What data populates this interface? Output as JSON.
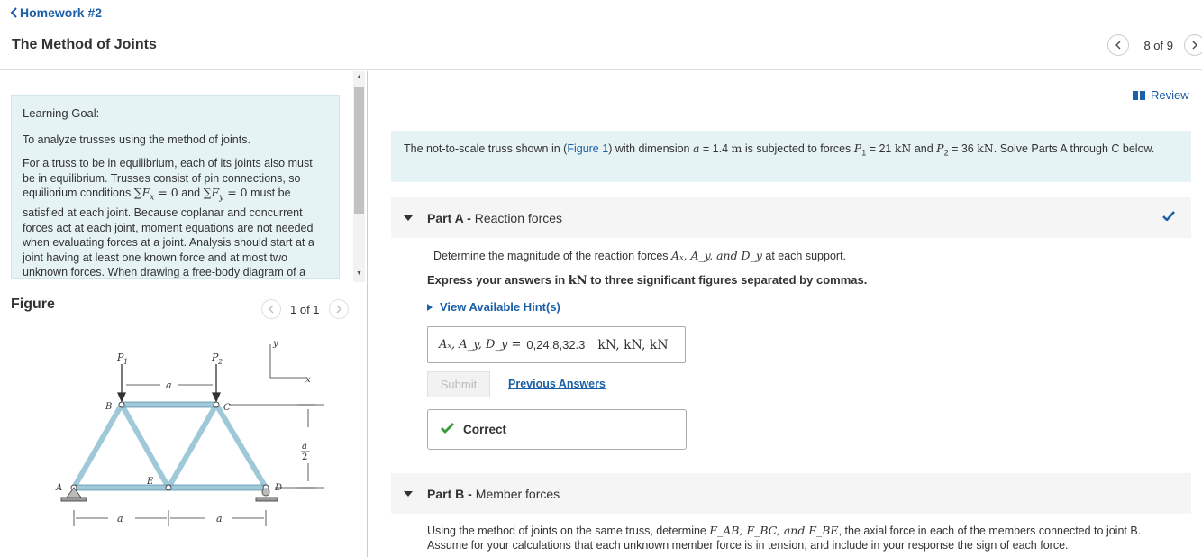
{
  "header": {
    "back_label": "Homework #2",
    "title": "The Method of Joints",
    "pager_text": "8 of 9"
  },
  "learning_goal": {
    "title": "Learning Goal:",
    "p1": "To analyze trusses using the method of joints.",
    "p2_a": "For a truss to be in equilibrium, each of its joints also must be in equilibrium. Trusses consist of pin connections, so equilibrium conditions ",
    "eq1": "∑F",
    "eq1_sub": "x",
    "eq1_rhs": " = 0",
    "p2_and": " and ",
    "eq2": "∑F",
    "eq2_sub": "y",
    "eq2_rhs": " = 0",
    "p2_b": " must be satisfied at each joint. Because coplanar and concurrent forces act at each joint, moment equations are not needed when evaluating forces at a joint. Analysis should start at a joint having at least one known force and at most two unknown forces. When drawing a free-body diagram of a joint, always assume unknown member forces are in"
  },
  "figure": {
    "label": "Figure",
    "pager_text": "1 of 1",
    "labels": {
      "P1": "P",
      "P1_sub": "1",
      "P2": "P",
      "P2_sub": "2",
      "a_top": "a",
      "y": "y",
      "x": "x",
      "B": "B",
      "C": "C",
      "A": "A",
      "D": "D",
      "E": "E",
      "half_num": "a",
      "half_den": "2",
      "a_left": "a",
      "a_right": "a"
    }
  },
  "review": {
    "label": "Review"
  },
  "intro": {
    "text_a": "The not-to-scale truss shown in (",
    "figure_link": "Figure 1",
    "text_b": ") with dimension ",
    "a_var": "a",
    "a_eq": " = 1.4 ",
    "a_unit": "m",
    "text_c": " is subjected to forces ",
    "p1_var": "P",
    "p1_sub": "1",
    "p1_eq": " = 21 ",
    "p1_unit": "kN",
    "text_d": " and ",
    "p2_var": "P",
    "p2_sub": "2",
    "p2_eq": " = 36 ",
    "p2_unit": "kN",
    "text_e": ". Solve Parts A through C below."
  },
  "part_a": {
    "part_label": "Part A - ",
    "part_title": "Reaction forces",
    "question_a": "Determine the magnitude of the reaction forces ",
    "question_vars": "Aₓ, A_y, and D_y",
    "question_b": " at each support.",
    "express_a": "Express your answers in ",
    "express_unit": "kN",
    "express_b": " to three significant figures separated by commas.",
    "hints_label": "View Available Hint(s)",
    "answer_label": "Aₓ, A_y, D_y =",
    "answer_value": "0,24.8,32.3",
    "answer_units": "kN, kN, kN",
    "submit_label": "Submit",
    "previous_answers_label": "Previous Answers",
    "correct_label": "Correct"
  },
  "part_b": {
    "part_label": "Part B - ",
    "part_title": "Member forces",
    "question_a": "Using the method of joints on the same truss, determine ",
    "question_vars": "F_AB, F_BC, and F_BE",
    "question_b": ", the axial force in each of the members connected to joint B. Assume for your calculations that each unknown member force is in tension, and include in your response the sign of each force."
  },
  "colors": {
    "link": "#1a5fa8",
    "info_bg": "#e6f3f5",
    "correct_green": "#3a9a3a"
  }
}
